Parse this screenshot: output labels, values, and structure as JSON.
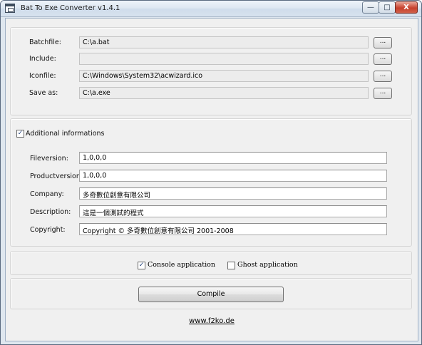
{
  "window": {
    "title": "Bat To Exe Converter v1.4.1"
  },
  "files": {
    "batchfile": {
      "label": "Batchfile:",
      "value": "C:\\a.bat"
    },
    "include": {
      "label": "Include:",
      "value": ""
    },
    "iconfile": {
      "label": "Iconfile:",
      "value": "C:\\Windows\\System32\\acwizard.ico"
    },
    "saveas": {
      "label": "Save as:",
      "value": "C:\\a.exe"
    },
    "browse_label": "..."
  },
  "info": {
    "checkbox_label": "Additional informations",
    "checked": true,
    "fileversion": {
      "label": "Fileversion:",
      "value": "1,0,0,0"
    },
    "productversion": {
      "label": "Productversion:",
      "value": "1,0,0,0"
    },
    "company": {
      "label": "Company:",
      "value": "多奇數位創意有限公司"
    },
    "description": {
      "label": "Description:",
      "value": "這是一個測試的程式"
    },
    "copyright": {
      "label": "Copyright:",
      "value": "Copyright © 多奇數位創意有限公司 2001-2008"
    }
  },
  "options": {
    "console": {
      "label": "Console application",
      "checked": true
    },
    "ghost": {
      "label": "Ghost application",
      "checked": false
    },
    "check_glyph": "✓"
  },
  "compile_label": "Compile",
  "link": "www.f2ko.de",
  "titlebar_glyphs": {
    "minimize": "—",
    "maximize": "□",
    "close": "X"
  }
}
